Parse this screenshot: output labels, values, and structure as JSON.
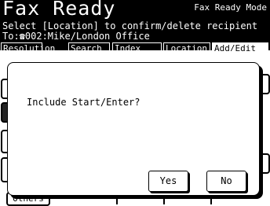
{
  "header": {
    "title": "Fax Ready",
    "mode": "Fax Ready Mode",
    "instruction": "Select [Location] to confirm/delete recipient",
    "to_line": "To:☎002:Mike/London Office"
  },
  "tabs": [
    {
      "label": "Resolution"
    },
    {
      "label": "Search"
    },
    {
      "label": "Index"
    },
    {
      "label": "Location"
    },
    {
      "label": "Add/Edit"
    }
  ],
  "background": {
    "bottom_button_label": "Others"
  },
  "dialog": {
    "question": "Include Start/Enter?",
    "yes_label": "Yes",
    "no_label": "No"
  }
}
